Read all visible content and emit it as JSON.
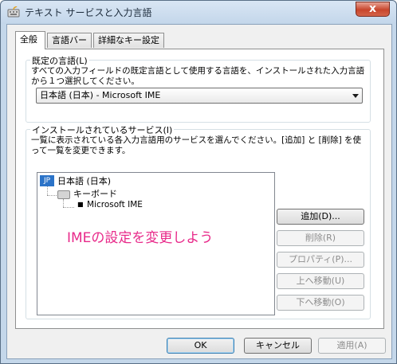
{
  "window": {
    "title": "テキスト サービスと入力言語",
    "close_glyph": "x"
  },
  "tabs": [
    {
      "label": "全般",
      "active": true
    },
    {
      "label": "言語バー",
      "active": false
    },
    {
      "label": "詳細なキー設定",
      "active": false
    }
  ],
  "default_language": {
    "group_title": "既定の言語(L)",
    "description": "すべての入力フィールドの既定言語として使用する言語を、インストールされた入力言語から１つ選択してください。",
    "selected": "日本語 (日本) - Microsoft IME"
  },
  "installed_services": {
    "group_title": "インストールされているサービス(I)",
    "description": "一覧に表示されている各入力言語用のサービスを選んでください。[追加] と [削除] を使って一覧を変更できます。",
    "tree": {
      "language_badge": "JP",
      "language": "日本語 (日本)",
      "category": "キーボード",
      "service": "Microsoft IME"
    },
    "buttons": {
      "add": "追加(D)...",
      "remove": "削除(R)",
      "properties": "プロパティ(P)...",
      "move_up": "上へ移動(U)",
      "move_down": "下へ移動(O)"
    }
  },
  "annotation": "IMEの設定を変更しよう",
  "footer": {
    "ok": "OK",
    "cancel": "キャンセル",
    "apply": "適用(A)"
  }
}
